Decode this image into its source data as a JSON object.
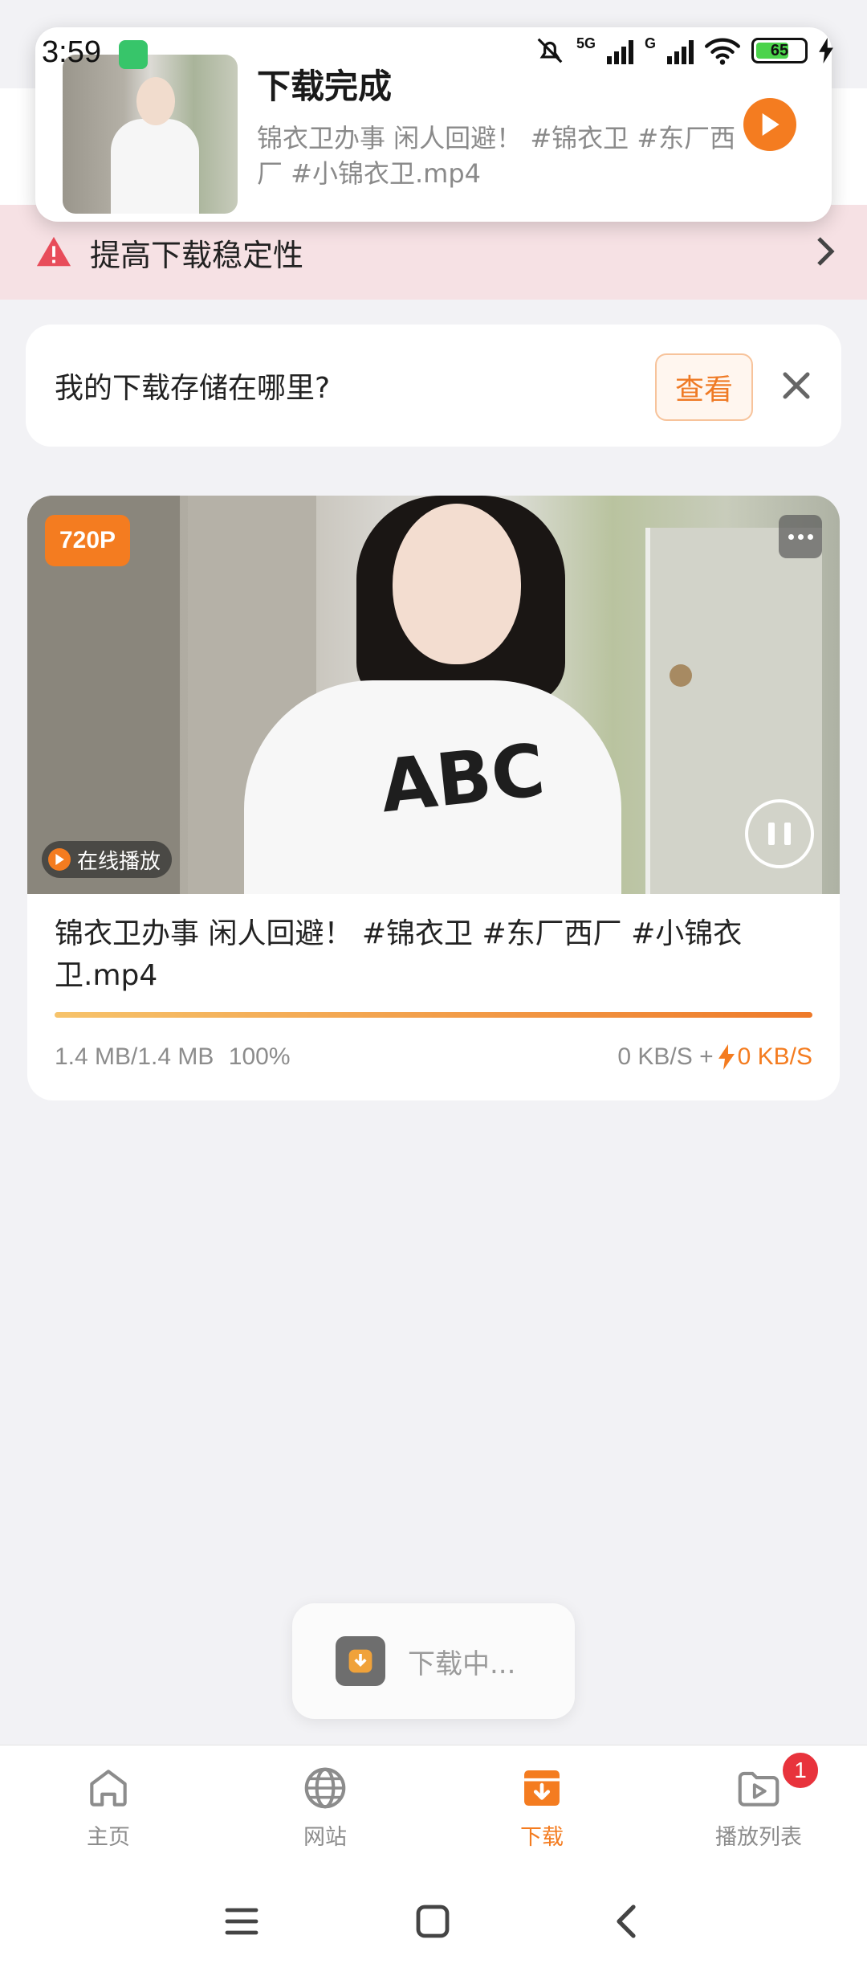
{
  "status_bar": {
    "time": "3:59",
    "network_1": "5G",
    "network_2": "G",
    "battery": "65"
  },
  "notification": {
    "title": "下载完成",
    "body": "锦衣卫办事 闲人回避！ #锦衣卫 #东厂西厂 #小锦衣卫.mp4",
    "play_icon": "play-icon"
  },
  "warning_banner": {
    "text": "提高下载稳定性",
    "icon": "warning-triangle-icon",
    "color": "#e84c5a"
  },
  "storage_tip": {
    "question": "我的下载存储在哪里?",
    "view_button": "查看",
    "close_icon": "close-icon"
  },
  "download_item": {
    "resolution": "720P",
    "online_play": "在线播放",
    "title": "锦衣卫办事 闲人回避！ #锦衣卫 #东厂西厂 #小锦衣卫.mp4",
    "progress": 1.0,
    "size": "1.4 MB/1.4 MB",
    "percent": "100%",
    "speed": "0 KB/S +",
    "boost_speed": "0 KB/S",
    "accent": "#f47c20"
  },
  "toast": {
    "text": "下载中..."
  },
  "bottom_nav": {
    "items": [
      {
        "label": "主页",
        "icon": "home-icon"
      },
      {
        "label": "网站",
        "icon": "globe-icon"
      },
      {
        "label": "下载",
        "icon": "download-icon"
      },
      {
        "label": "播放列表",
        "icon": "playlist-icon"
      }
    ],
    "active_index": 2,
    "playlist_badge": "1"
  },
  "system_nav": {
    "icons": [
      "menu-icon",
      "home-square-icon",
      "back-icon"
    ]
  }
}
